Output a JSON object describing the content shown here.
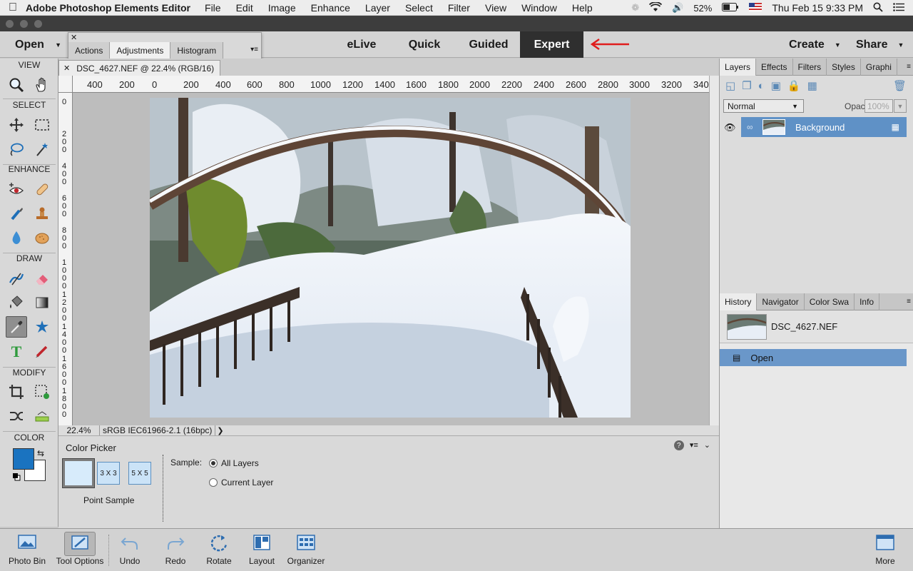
{
  "menubar": {
    "app_name": "Adobe Photoshop Elements Editor",
    "items": [
      "File",
      "Edit",
      "Image",
      "Enhance",
      "Layer",
      "Select",
      "Filter",
      "View",
      "Window",
      "Help"
    ],
    "battery": "52%",
    "datetime": "Thu Feb 15  9:33 PM"
  },
  "modebar": {
    "open_label": "Open",
    "tabs": [
      "eLive",
      "Quick",
      "Guided",
      "Expert"
    ],
    "active_tab": "Expert",
    "create_label": "Create",
    "share_label": "Share"
  },
  "float_panel": {
    "tabs": [
      "Actions",
      "Adjustments",
      "Histogram"
    ],
    "active_tab": "Adjustments"
  },
  "toolbox": {
    "sections": [
      "VIEW",
      "SELECT",
      "ENHANCE",
      "DRAW",
      "MODIFY",
      "COLOR"
    ],
    "fg_color": "#1a73c0",
    "bg_color": "#ffffff"
  },
  "document": {
    "tab_title": "DSC_4627.NEF @ 22.4% (RGB/16)",
    "zoom": "22.4%",
    "profile": "sRGB IEC61966-2.1 (16bpc)",
    "ruler_h": [
      "400",
      "200",
      "0",
      "200",
      "400",
      "600",
      "800",
      "1000",
      "1200",
      "1400",
      "1600",
      "1800",
      "2000",
      "2200",
      "2400",
      "2600",
      "2800",
      "3000",
      "3200",
      "340"
    ],
    "ruler_v": [
      "0",
      "200",
      "400",
      "600",
      "800",
      "1000",
      "1200",
      "1400",
      "1600",
      "1800"
    ]
  },
  "tool_options": {
    "title": "Color Picker",
    "samples": [
      "",
      "3 X 3",
      "5 X 5"
    ],
    "sample_caption": "Point Sample",
    "sample_label": "Sample:",
    "radio_all": "All Layers",
    "radio_current": "Current Layer"
  },
  "layers_panel": {
    "tabs": [
      "Layers",
      "Effects",
      "Filters",
      "Styles",
      "Graphi"
    ],
    "active_tab": "Layers",
    "blend_mode": "Normal",
    "opacity_label": "Opacity:",
    "opacity_value": "100%",
    "layer_name": "Background"
  },
  "history_panel": {
    "tabs": [
      "History",
      "Navigator",
      "Color Swa",
      "Info"
    ],
    "active_tab": "History",
    "snapshot_name": "DSC_4627.NEF",
    "step": "Open"
  },
  "taskbar": {
    "buttons": [
      "Photo Bin",
      "Tool Options",
      "Undo",
      "Redo",
      "Rotate",
      "Layout",
      "Organizer"
    ],
    "more": "More"
  }
}
